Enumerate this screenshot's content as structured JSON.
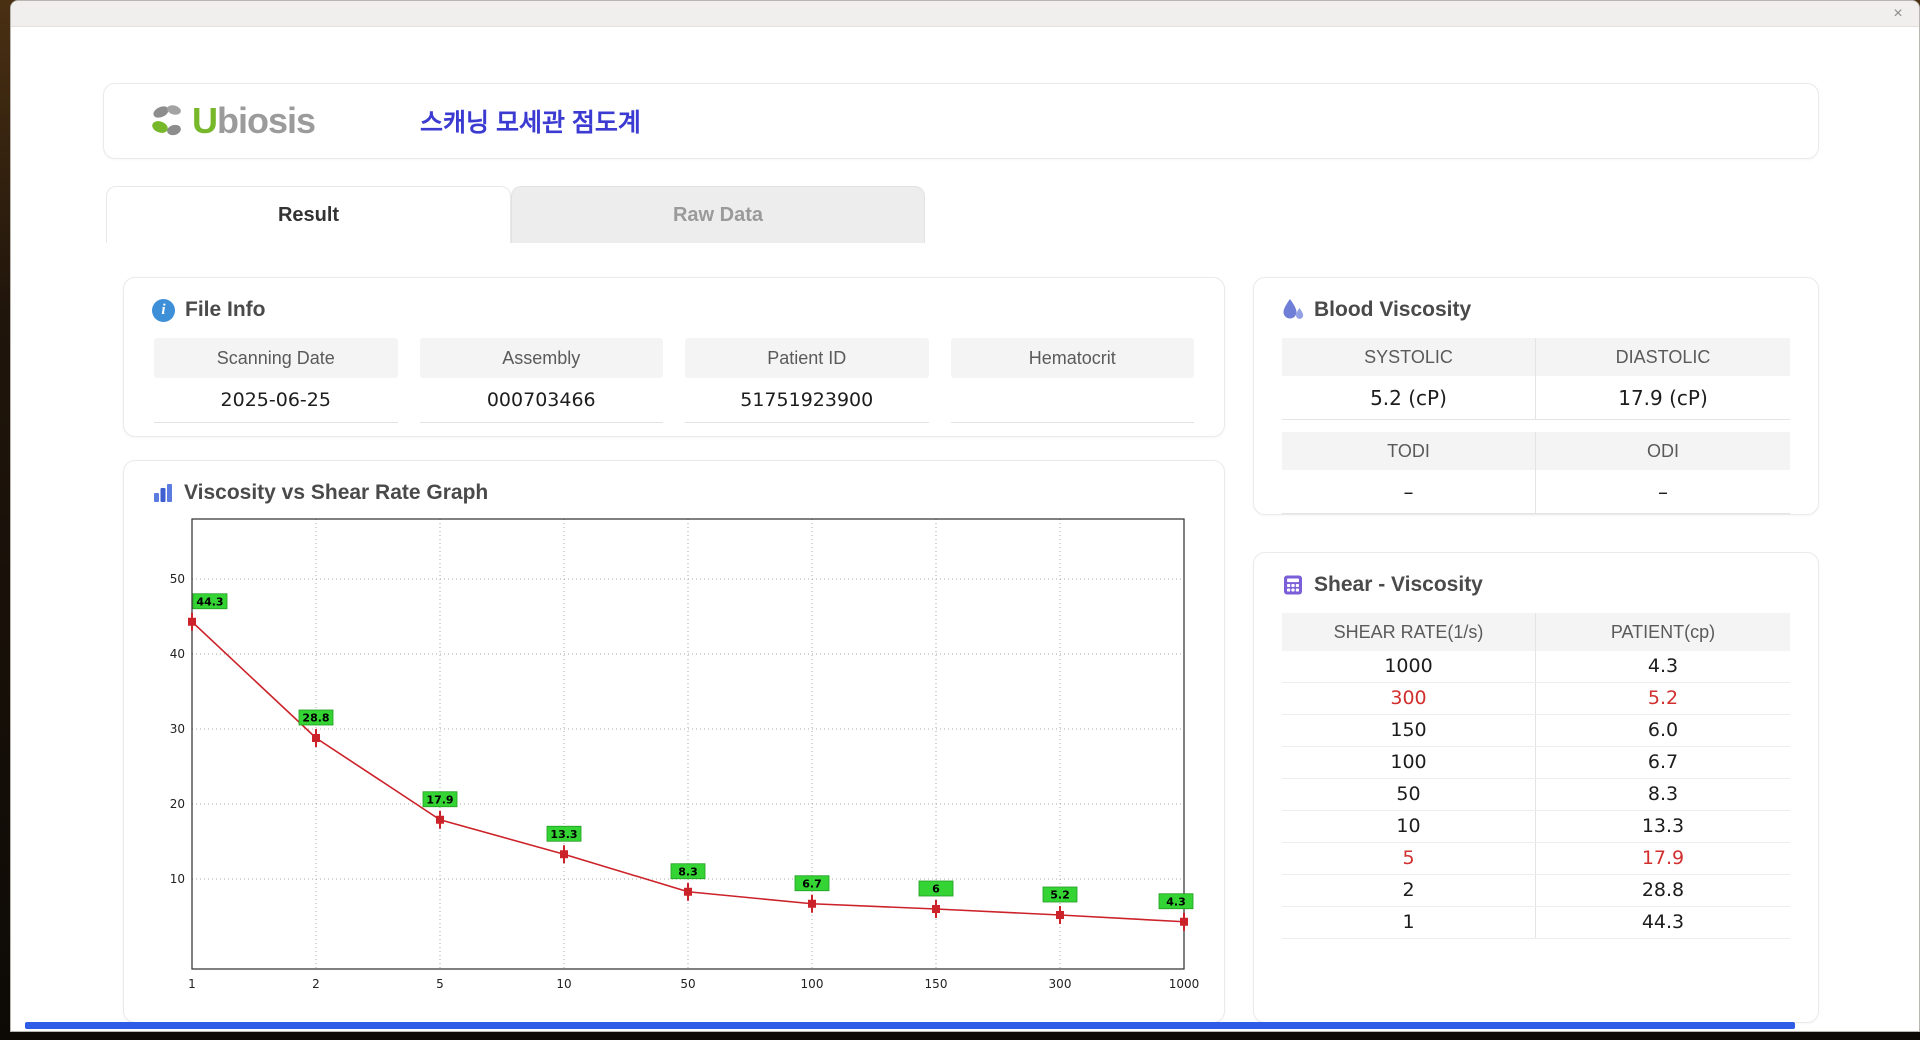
{
  "window": {
    "close_label": "×"
  },
  "header": {
    "brand_u": "U",
    "brand_rest": "biosis",
    "title": "스캐닝 모세관 점도계"
  },
  "tabs": [
    {
      "label": "Result",
      "active": true
    },
    {
      "label": "Raw Data",
      "active": false
    }
  ],
  "file_info": {
    "title": "File Info",
    "fields": [
      {
        "label": "Scanning Date",
        "value": "2025-06-25"
      },
      {
        "label": "Assembly",
        "value": "000703466"
      },
      {
        "label": "Patient ID",
        "value": "51751923900"
      },
      {
        "label": "Hematocrit",
        "value": ""
      }
    ]
  },
  "blood_viscosity": {
    "title": "Blood Viscosity",
    "cells": [
      {
        "label": "SYSTOLIC",
        "value": "5.2 (cP)"
      },
      {
        "label": "DIASTOLIC",
        "value": "17.9 (cP)"
      },
      {
        "label": "TODI",
        "value": "–"
      },
      {
        "label": "ODI",
        "value": "–"
      }
    ]
  },
  "graph": {
    "title": "Viscosity vs Shear Rate Graph"
  },
  "chart_data": {
    "type": "line",
    "title": "Viscosity vs Shear Rate Graph",
    "x": [
      "1",
      "2",
      "5",
      "10",
      "50",
      "100",
      "150",
      "300",
      "1000"
    ],
    "x_scale": "category",
    "series": [
      {
        "name": "PATIENT",
        "values": [
          44.3,
          28.8,
          17.9,
          13.3,
          8.3,
          6.7,
          6,
          5.2,
          4.3
        ]
      }
    ],
    "labels": [
      "44.3",
      "28.8",
      "17.9",
      "13.3",
      "8.3",
      "6.7",
      "6",
      "5.2",
      "4.3"
    ],
    "xlabel": "",
    "ylabel": "",
    "ylim": [
      0,
      58
    ],
    "render_ymin": -2,
    "render_ymax": 58,
    "yticks": [
      10,
      20,
      30,
      40,
      50
    ],
    "grid": true,
    "legend": "none",
    "line_color": "#cc2229",
    "marker_color": "#cc2229",
    "label_bg": "#35d435"
  },
  "shear_table": {
    "title": "Shear - Viscosity",
    "columns": [
      "SHEAR RATE(1/s)",
      "PATIENT(cp)"
    ],
    "rows": [
      {
        "shear": "1000",
        "patient": "4.3",
        "highlight": false
      },
      {
        "shear": "300",
        "patient": "5.2",
        "highlight": true
      },
      {
        "shear": "150",
        "patient": "6.0",
        "highlight": false
      },
      {
        "shear": "100",
        "patient": "6.7",
        "highlight": false
      },
      {
        "shear": "50",
        "patient": "8.3",
        "highlight": false
      },
      {
        "shear": "10",
        "patient": "13.3",
        "highlight": false
      },
      {
        "shear": "5",
        "patient": "17.9",
        "highlight": true
      },
      {
        "shear": "2",
        "patient": "28.8",
        "highlight": false
      },
      {
        "shear": "1",
        "patient": "44.3",
        "highlight": false
      }
    ]
  },
  "icons": {
    "file_info": "info-icon",
    "blood_viscosity": "droplet-icon",
    "graph": "bar-chart-icon",
    "shear": "table-icon",
    "close": "close-icon",
    "brand": "leaves-icon"
  },
  "colors": {
    "title_accent": "#3b3bd2",
    "brand_green": "#76b82a",
    "brand_gray": "#9b9b9b",
    "highlight_red": "#d22f2f",
    "chart_line": "#cc2229",
    "chart_label_bg": "#35d435",
    "table_header_bg": "#f4f4f4"
  }
}
